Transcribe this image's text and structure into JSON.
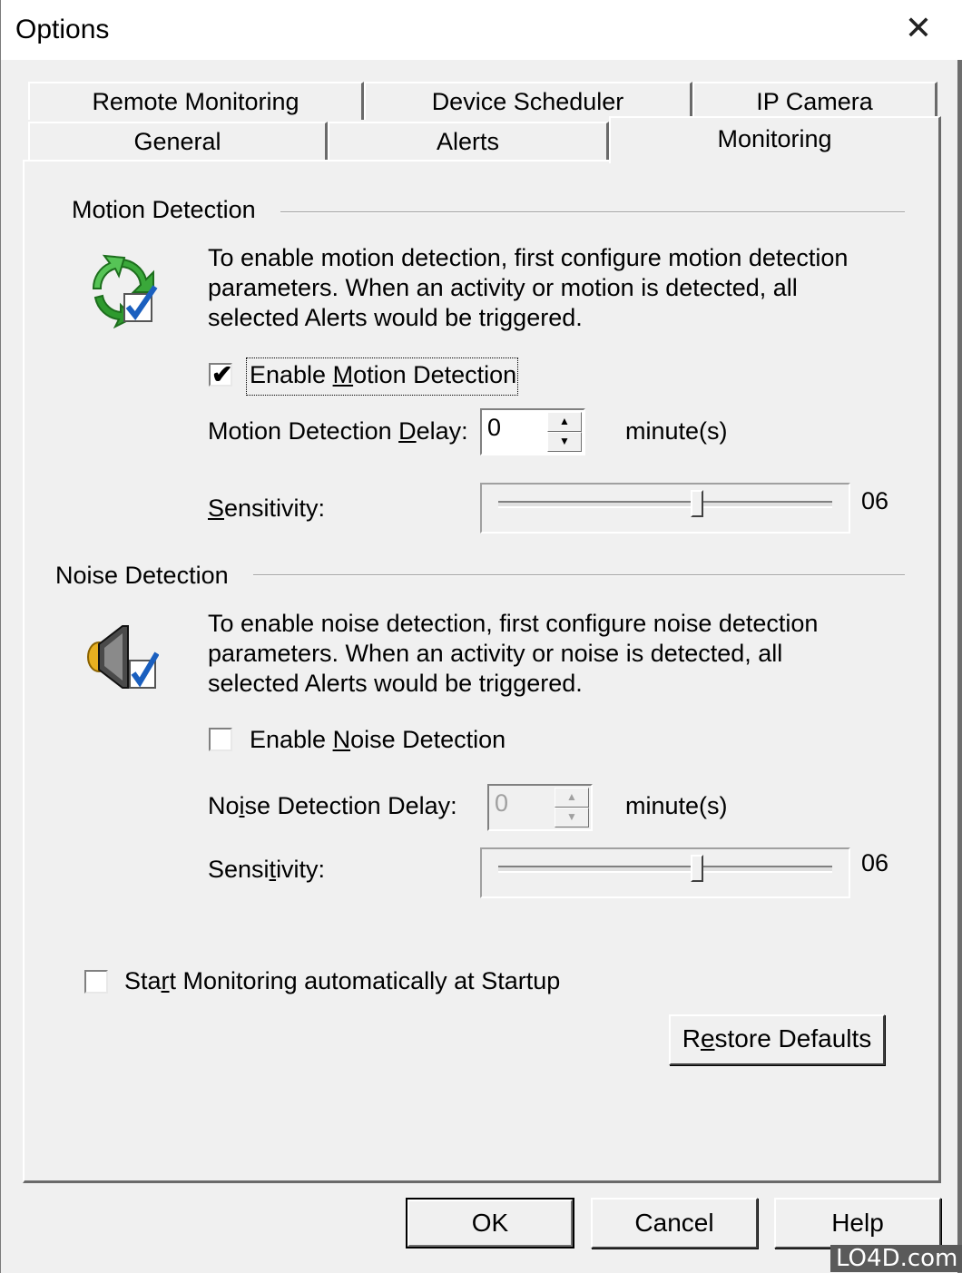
{
  "window": {
    "title": "Options"
  },
  "tabs": {
    "row1": [
      "Remote Monitoring",
      "Device Scheduler",
      "IP Camera"
    ],
    "row2": [
      "General",
      "Alerts",
      "Monitoring"
    ],
    "active": "Monitoring"
  },
  "motion": {
    "group_label": "Motion Detection",
    "description": "To enable motion detection, first configure motion detection parameters. When an activity or motion is detected, all selected Alerts would be triggered.",
    "desc_lines": [
      "To enable motion detection, first configure motion detection",
      "parameters. When an activity or motion is detected, all",
      "selected Alerts would be triggered."
    ],
    "enable_pre": "Enable ",
    "enable_u": "M",
    "enable_post": "otion Detection",
    "enable_checked": true,
    "delay_pre": "Motion Detection ",
    "delay_u": "D",
    "delay_post": "elay:",
    "delay_value": "0",
    "delay_unit": "minute(s)",
    "sens_u": "S",
    "sens_post": "ensitivity:",
    "sensitivity_value": "06",
    "sensitivity_level": 0.6
  },
  "noise": {
    "group_label": "Noise Detection",
    "desc_lines": [
      "To enable noise detection, first configure noise detection",
      "parameters. When an activity or noise is detected, all",
      "selected Alerts would be triggered."
    ],
    "enable_pre": "Enable ",
    "enable_u": "N",
    "enable_post": "oise Detection",
    "enable_checked": false,
    "delay_pre": "No",
    "delay_u": "i",
    "delay_post": "se Detection Delay:",
    "delay_value": "0",
    "delay_unit": "minute(s)",
    "sens_pre": "Sensi",
    "sens_u": "t",
    "sens_post": "ivity:",
    "sensitivity_value": "06",
    "sensitivity_level": 0.6
  },
  "startup": {
    "pre": "Sta",
    "u": "r",
    "post": "t Monitoring automatically at Startup",
    "checked": false
  },
  "restore": {
    "pre": "R",
    "u": "e",
    "post": "store Defaults"
  },
  "buttons": {
    "ok": "OK",
    "cancel": "Cancel",
    "help": "Help"
  },
  "watermark": "LO4D.com"
}
